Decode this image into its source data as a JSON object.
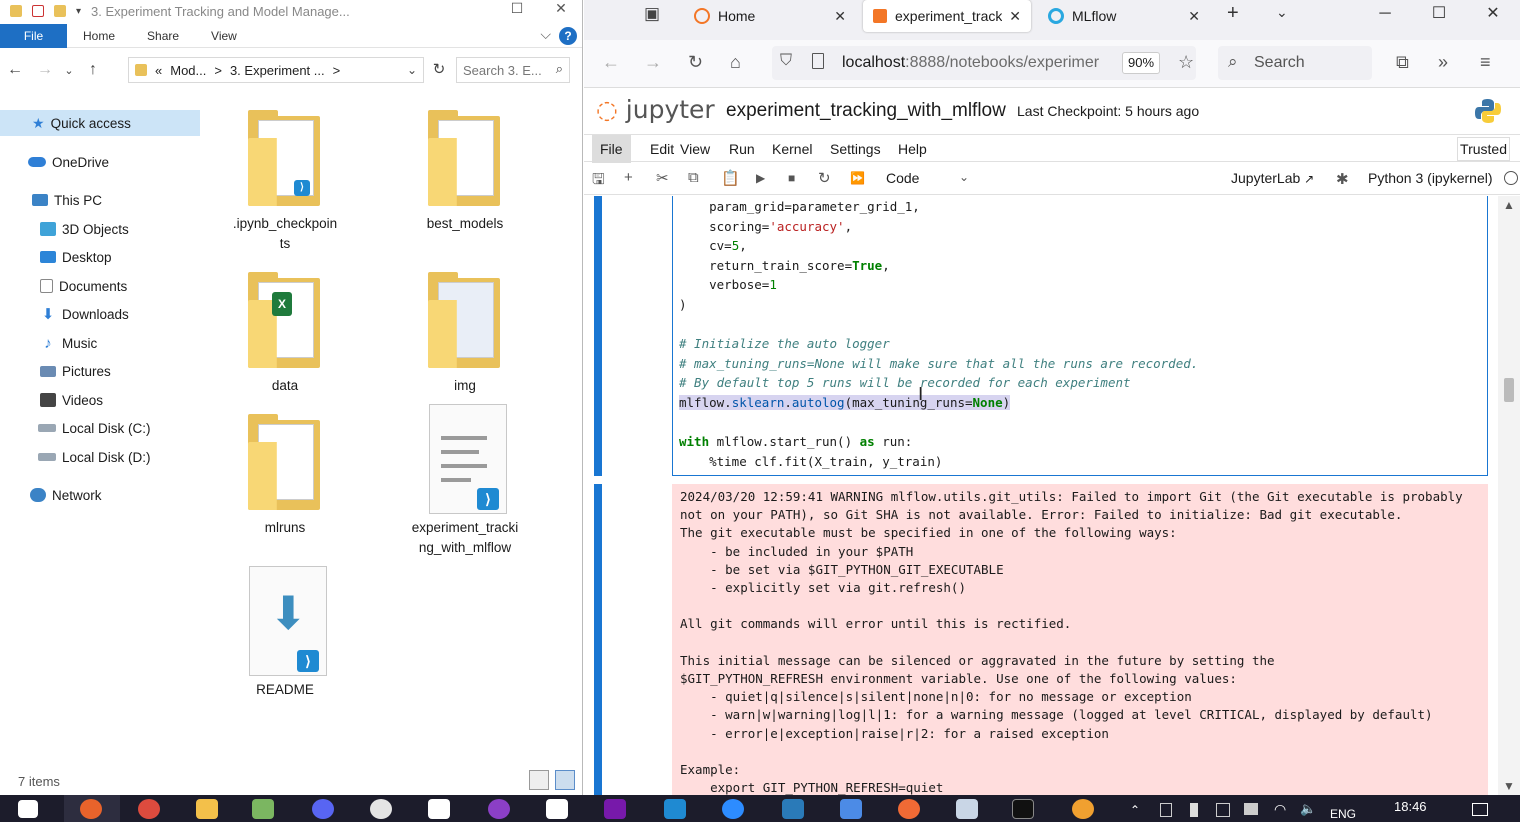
{
  "explorer": {
    "title": "3. Experiment Tracking and Model Manage...",
    "ribbon": {
      "file": "File",
      "home": "Home",
      "share": "Share",
      "view": "View"
    },
    "address": {
      "crumb_prefix": "«",
      "crumb1": "Mod...",
      "crumb2": "3. Experiment ...",
      "sep": ">"
    },
    "search_placeholder": "Search 3. E...",
    "nav": [
      {
        "label": "Quick access",
        "icon": "star-icon"
      },
      {
        "label": "OneDrive",
        "icon": "cloud-icon"
      },
      {
        "label": "This PC",
        "icon": "computer-icon"
      },
      {
        "label": "3D Objects",
        "icon": "cube-icon"
      },
      {
        "label": "Desktop",
        "icon": "desktop-icon"
      },
      {
        "label": "Documents",
        "icon": "documents-icon"
      },
      {
        "label": "Downloads",
        "icon": "download-icon"
      },
      {
        "label": "Music",
        "icon": "music-icon"
      },
      {
        "label": "Pictures",
        "icon": "pictures-icon"
      },
      {
        "label": "Videos",
        "icon": "videos-icon"
      },
      {
        "label": "Local Disk (C:)",
        "icon": "drive-icon"
      },
      {
        "label": "Local Disk (D:)",
        "icon": "drive-icon"
      },
      {
        "label": "Network",
        "icon": "network-icon"
      }
    ],
    "items": [
      {
        "label": ".ipynb_checkpoin\nts"
      },
      {
        "label": "best_models"
      },
      {
        "label": "data"
      },
      {
        "label": "img"
      },
      {
        "label": "mlruns"
      },
      {
        "label": "experiment_tracki\nng_with_mlflow"
      },
      {
        "label": "README"
      }
    ],
    "status": "7 items"
  },
  "browser": {
    "tabs": [
      {
        "label": "Home"
      },
      {
        "label": "experiment_track"
      },
      {
        "label": "MLflow"
      }
    ],
    "url_host": "localhost",
    "url_path": ":8888/notebooks/experimer",
    "zoom": "90%",
    "search_placeholder": "Search"
  },
  "jupyter": {
    "logo": "jupyter",
    "notebook_name": "experiment_tracking_with_mlflow",
    "checkpoint": "Last Checkpoint: 5 hours ago",
    "menu": [
      "File",
      "Edit",
      "View",
      "Run",
      "Kernel",
      "Settings",
      "Help"
    ],
    "trusted": "Trusted",
    "cell_type": "Code",
    "jupyterlab": "JupyterLab",
    "kernel": "Python 3 (ipykernel)"
  },
  "code": {
    "l1": "    param_grid=parameter_grid_1,",
    "l2a": "    scoring=",
    "l2b": "'accuracy'",
    "l2c": ",",
    "l3a": "    cv=",
    "l3b": "5",
    "l3c": ",",
    "l4a": "    return_train_score=",
    "l4b": "True",
    "l4c": ",",
    "l5a": "    verbose=",
    "l5b": "1",
    "l6": ")",
    "c1": "# Initialize the auto logger",
    "c2": "# max_tuning_runs=None will make sure that all the runs are recorded.",
    "c3": "# By default top 5 runs will be recorded for each experiment",
    "m1a": "mlflow.",
    "m1b": "sklearn",
    "m1c": ".",
    "m1d": "autolog",
    "m1e": "(max_tuning_runs=",
    "m1f": "None",
    "m1g": ")",
    "w1": "with",
    "w2": " mlflow.start_run() ",
    "w3": "as",
    "w4": " run:",
    "t1": "    %time clf.fit(X_train, y_train)"
  },
  "output": "2024/03/20 12:59:41 WARNING mlflow.utils.git_utils: Failed to import Git (the Git executable is probably\nnot on your PATH), so Git SHA is not available. Error: Failed to initialize: Bad git executable.\nThe git executable must be specified in one of the following ways:\n    - be included in your $PATH\n    - be set via $GIT_PYTHON_GIT_EXECUTABLE\n    - explicitly set via git.refresh()\n\nAll git commands will error until this is rectified.\n\nThis initial message can be silenced or aggravated in the future by setting the\n$GIT_PYTHON_REFRESH environment variable. Use one of the following values:\n    - quiet|q|silence|s|silent|none|n|0: for no message or exception\n    - warn|w|warning|log|l|1: for a warning message (logged at level CRITICAL, displayed by default)\n    - error|e|exception|raise|r|2: for a raised exception\n\nExample:\n    export GIT_PYTHON_REFRESH=quiet",
  "taskbar": {
    "lang": "ENG",
    "time": "18:46"
  }
}
